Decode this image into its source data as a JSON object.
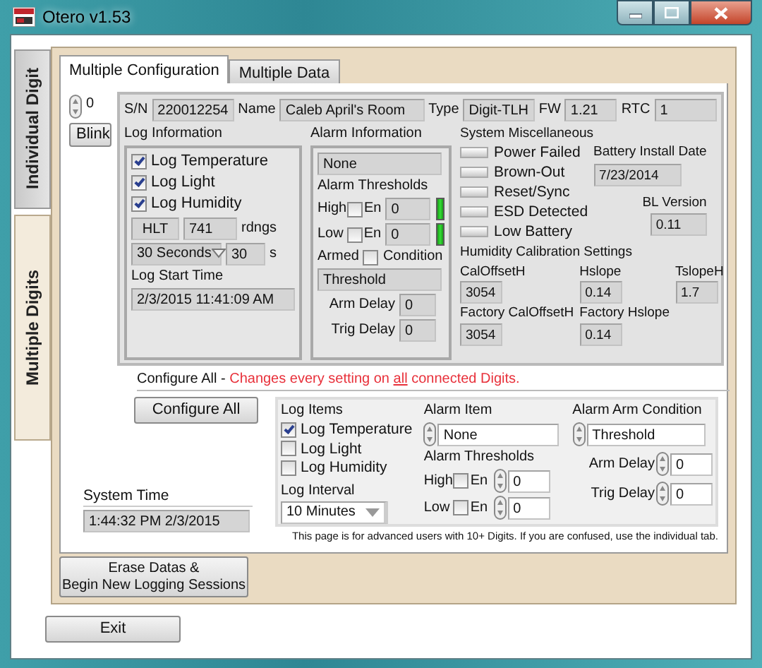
{
  "window": {
    "title": "Otero v1.53"
  },
  "side_tabs": [
    {
      "label": "Individual Digit",
      "selected": false
    },
    {
      "label": "Multiple Digits",
      "selected": true
    }
  ],
  "tabs": [
    {
      "label": "Multiple Configuration",
      "selected": true
    },
    {
      "label": "Multiple Data",
      "selected": false
    }
  ],
  "digit_index": "0",
  "blink_button": "Blink",
  "device_fields": [
    {
      "label": "S/N",
      "value": "220012254"
    },
    {
      "label": "Name",
      "value": "Caleb April's Room"
    },
    {
      "label": "Type",
      "value": "Digit-TLH"
    },
    {
      "label": "FW",
      "value": "1.21"
    },
    {
      "label": "RTC",
      "value": "1"
    }
  ],
  "log_information": {
    "title": "Log Information",
    "items": [
      {
        "label": "Log Temperature",
        "checked": true
      },
      {
        "label": "Log Light",
        "checked": true
      },
      {
        "label": "Log Humidity",
        "checked": true
      }
    ],
    "mode": "HLT",
    "readings": "741",
    "readings_unit": "rdngs",
    "interval": "30 Seconds",
    "interval_value": "30",
    "interval_unit": "s",
    "start_label": "Log Start Time",
    "start_time": "2/3/2015 11:41:09 AM"
  },
  "alarm_information": {
    "title": "Alarm Information",
    "item": "None",
    "thresholds_label": "Alarm Thresholds",
    "thresholds": [
      {
        "label": "High",
        "enable_label": "En",
        "enabled": false,
        "value": "0",
        "indicator_on": true
      },
      {
        "label": "Low",
        "enable_label": "En",
        "enabled": false,
        "value": "0",
        "indicator_on": true
      }
    ],
    "armed_label": "Armed",
    "armed": false,
    "condition_label": "Condition",
    "condition": "Threshold",
    "delays": [
      {
        "label": "Arm Delay",
        "value": "0"
      },
      {
        "label": "Trig Delay",
        "value": "0"
      }
    ]
  },
  "system_misc": {
    "title": "System Miscellaneous",
    "indicators": [
      {
        "label": "Power Failed",
        "on": false
      },
      {
        "label": "Brown-Out",
        "on": false
      },
      {
        "label": "Reset/Sync",
        "on": false
      },
      {
        "label": "ESD Detected",
        "on": false
      },
      {
        "label": "Low Battery",
        "on": false
      }
    ],
    "battery_label": "Battery Install Date",
    "battery_date": "7/23/2014",
    "bl_label": "BL Version",
    "bl_version": "0.11"
  },
  "humidity_calibration": {
    "title": "Humidity Calibration Settings",
    "fields": [
      {
        "label": "CalOffsetH",
        "value": "3054"
      },
      {
        "label": "Hslope",
        "value": "0.14"
      },
      {
        "label": "TslopeH",
        "value": "1.7"
      },
      {
        "label": "Factory CalOffsetH",
        "value": "3054"
      },
      {
        "label": "Factory Hslope",
        "value": "0.14"
      }
    ]
  },
  "configure_all": {
    "heading": "Configure All - ",
    "warning_parts": [
      {
        "text": "Changes every setting on ",
        "underline": false
      },
      {
        "text": "all",
        "underline": true
      },
      {
        "text": " connected Digits.",
        "underline": false
      }
    ],
    "button": "Configure All",
    "log_items_label": "Log Items",
    "log_items": [
      {
        "label": "Log Temperature",
        "checked": true
      },
      {
        "label": "Log Light",
        "checked": false
      },
      {
        "label": "Log Humidity",
        "checked": false
      }
    ],
    "log_interval_label": "Log Interval",
    "log_interval": "10 Minutes",
    "alarm_item_label": "Alarm Item",
    "alarm_item": "None",
    "thresholds_label": "Alarm Thresholds",
    "thresholds": [
      {
        "label": "High",
        "enable_label": "En",
        "enabled": false,
        "value": "0"
      },
      {
        "label": "Low",
        "enable_label": "En",
        "enabled": false,
        "value": "0"
      }
    ],
    "arm_condition_label": "Alarm Arm Condition",
    "arm_condition": "Threshold",
    "delays": [
      {
        "label": "Arm Delay",
        "value": "0"
      },
      {
        "label": "Trig Delay",
        "value": "0"
      }
    ],
    "note": "This page is for advanced users with 10+ Digits. If you are confused, use the individual tab."
  },
  "system_time": {
    "label": "System Time",
    "value": "1:44:32 PM 2/3/2015"
  },
  "erase_button": [
    "Erase Datas &",
    "Begin New Logging Sessions"
  ],
  "exit_button": "Exit"
}
